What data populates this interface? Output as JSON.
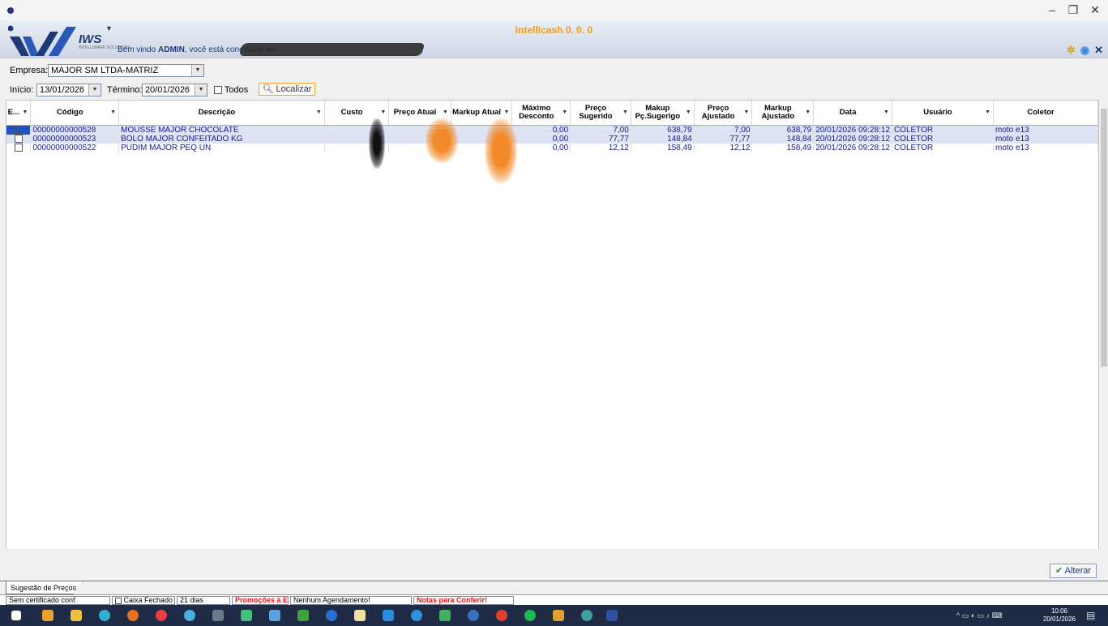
{
  "window": {
    "minimize": "–",
    "restore": "❐",
    "close": "✕"
  },
  "header": {
    "app_title": "Intellicash 0. 0. 0",
    "brand": "IWS",
    "brand_sub": "INTELLIWARE SOLUTIONS",
    "welcome_pre": "Bem vindo ",
    "welcome_user": "ADMIN",
    "welcome_post": ", você está conectado em"
  },
  "filters": {
    "empresa_label": "Empresa:",
    "empresa_value": "MAJOR SM LTDA-MATRIZ",
    "inicio_label": "Início:",
    "inicio_value": "13/01/2026",
    "termino_label": "Término:",
    "termino_value": "20/01/2026",
    "todos_label": "Todos",
    "localizar_label": "Localizar"
  },
  "columns": [
    "E...",
    "Código",
    "Descrição",
    "Custo",
    "Preço Atual",
    "Markup Atual",
    "Máximo Desconto",
    "Preço Sugerido",
    "Makup Pç.Sugerigo",
    "Preço Ajustado",
    "Markup Ajustado",
    "Data",
    "Usuário",
    "Coletor"
  ],
  "rows": [
    {
      "codigo": "00000000000528",
      "descricao": "MOUSSE MAJOR CHOCOLATE",
      "custo": "",
      "preco_atual": "",
      "markup_atual": "",
      "max_desc": "0,00",
      "preco_sug": "7,00",
      "makup_sug": "638,79",
      "preco_aj": "7,00",
      "markup_aj": "638,79",
      "data": "20/01/2026 09:28:12",
      "usuario": "COLETOR",
      "coletor": "moto e13"
    },
    {
      "codigo": "00000000000523",
      "descricao": "BOLO MAJOR CONFEITADO KG",
      "custo": "",
      "preco_atual": "",
      "markup_atual": "",
      "max_desc": "0,00",
      "preco_sug": "77,77",
      "makup_sug": "148,84",
      "preco_aj": "77,77",
      "markup_aj": "148,84",
      "data": "20/01/2026 09:28:12",
      "usuario": "COLETOR",
      "coletor": "moto e13"
    },
    {
      "codigo": "00000000000522",
      "descricao": "PUDIM MAJOR PEQ UN",
      "custo": "",
      "preco_atual": "",
      "markup_atual": "",
      "max_desc": "0,00",
      "preco_sug": "12,12",
      "makup_sug": "158,49",
      "preco_aj": "12,12",
      "markup_aj": "158,49",
      "data": "20/01/2026 09:28:12",
      "usuario": "COLETOR",
      "coletor": "moto e13"
    }
  ],
  "actions": {
    "alterar": "Alterar"
  },
  "tab": {
    "label": "Sugestão de Preços"
  },
  "status": {
    "cert": "Sem certificado conf.",
    "caixa": "Caixa Fechado",
    "dias": "21 dias",
    "promo": "Promoções à Exportar!",
    "agenda": "Nenhum Agendamento!",
    "notas": "Notas para Conferir!"
  },
  "taskbar": {
    "time": "10:06",
    "date": "20/01/2026"
  },
  "colors": {
    "accent": "#f39c12",
    "brand": "#1e3a78",
    "alert": "#e8141a"
  }
}
